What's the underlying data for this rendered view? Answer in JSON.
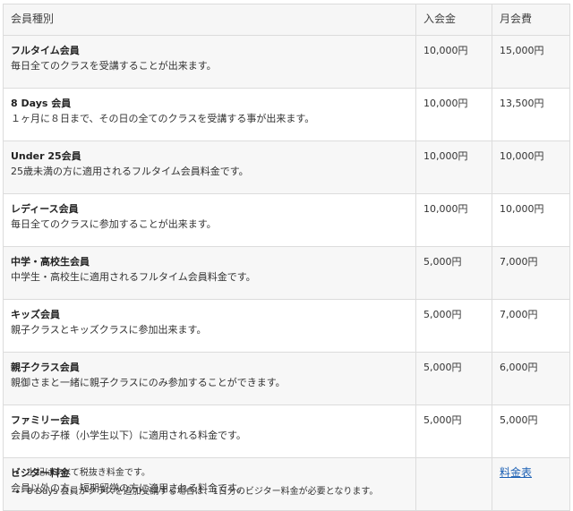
{
  "table": {
    "headers": {
      "type": "会員種別",
      "entry_fee": "入会金",
      "monthly_fee": "月会費"
    },
    "rows": [
      {
        "name": "フルタイム会員",
        "desc": "毎日全てのクラスを受講することが出来ます。",
        "entry": "10,000円",
        "monthly": "15,000円"
      },
      {
        "name": "8 Days 会員",
        "desc": "１ヶ月に８日まで、その日の全てのクラスを受講する事が出来ます。",
        "entry": "10,000円",
        "monthly": "13,500円"
      },
      {
        "name": "Under 25会員",
        "desc": "25歳未満の方に適用されるフルタイム会員料金です。",
        "entry": "10,000円",
        "monthly": "10,000円"
      },
      {
        "name": "レディース会員",
        "desc": "毎日全てのクラスに参加することが出来ます。",
        "entry": "10,000円",
        "monthly": "10,000円"
      },
      {
        "name": "中学・高校生会員",
        "desc": "中学生・高校生に適用されるフルタイム会員料金です。",
        "entry": "5,000円",
        "monthly": "7,000円"
      },
      {
        "name": "キッズ会員",
        "desc": "親子クラスとキッズクラスに参加出来ます。",
        "entry": "5,000円",
        "monthly": "7,000円"
      },
      {
        "name": "親子クラス会員",
        "desc": "親御さまと一緒に親子クラスにのみ参加することができます。",
        "entry": "5,000円",
        "monthly": "6,000円"
      },
      {
        "name": "ファミリー会員",
        "desc": "会員のお子様（小学生以下）に適用される料金です。",
        "entry": "5,000円",
        "monthly": "5,000円"
      },
      {
        "name": "ビジター料金",
        "desc": "会員以外の方、短期留学の方に適用される料金です。",
        "entry": "",
        "monthly_link": "料金表"
      }
    ]
  },
  "notes": [
    "上記はすべて税抜き料金です。",
    "8 Days 会員がクラスを追加受講する場合は、1日分のビジター料金が必要となります。"
  ]
}
